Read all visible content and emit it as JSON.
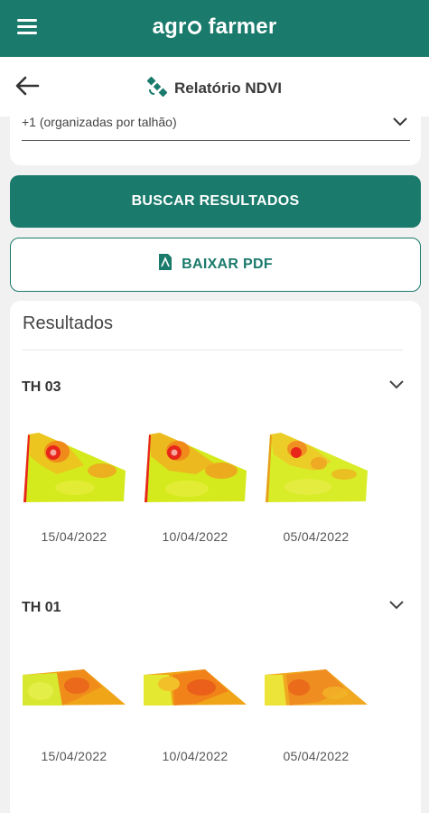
{
  "app": {
    "brand_prefix": "agr",
    "brand_suffix": "farmer",
    "accent": "#1a7a6b"
  },
  "header": {
    "title": "Relatório NDVI"
  },
  "filter": {
    "selected_value": "+1 (organizadas por talhão)"
  },
  "actions": {
    "search_label": "BUSCAR RESULTADOS",
    "pdf_label": "BAIXAR PDF"
  },
  "results": {
    "title": "Resultados",
    "groups": [
      {
        "name": "TH 03",
        "dates": [
          "15/04/2022",
          "10/04/2022",
          "05/04/2022"
        ]
      },
      {
        "name": "TH 01",
        "dates": [
          "15/04/2022",
          "10/04/2022",
          "05/04/2022"
        ]
      }
    ]
  }
}
